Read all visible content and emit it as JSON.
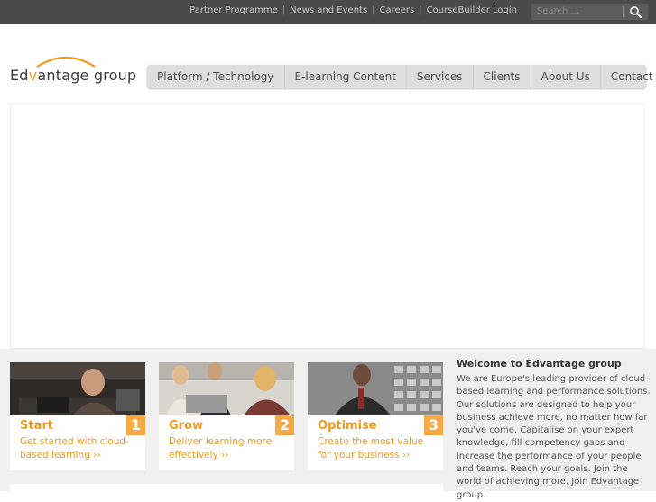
{
  "topbar": {
    "links": [
      "Partner Programme",
      "News and Events",
      "Careers",
      "CourseBuilder Login"
    ],
    "search_placeholder": "Search ..."
  },
  "logo": {
    "text_left": "Ed",
    "text_mid": "v",
    "text_right": "antage group"
  },
  "nav": {
    "items": [
      "Platform / Technology",
      "E-learning Content",
      "Services",
      "Clients",
      "About Us",
      "Contact Us"
    ]
  },
  "cards": [
    {
      "number": "1",
      "title": "Start",
      "desc": "Get started with cloud-based learning ››"
    },
    {
      "number": "2",
      "title": "Grow",
      "desc": "Deliver learning more effectively ››"
    },
    {
      "number": "3",
      "title": "Optimise",
      "desc": "Create the most value for your business ››"
    }
  ],
  "welcome": {
    "title": "Welcome to Edvantage group",
    "body": "We are Europe's leading provider of cloud-based learning and performance solutions. Our solutions are designed to help your business achieve more, no matter how far you've come. Capitalise on your expert knowledge, fill competency gaps and increase the performance of your people and teams. Reach your goals. Join the world of achieving more. Join Edvantage group."
  },
  "colors": {
    "accent": "#f29a1e",
    "topbar": "#4a4a4a",
    "nav": "#dedede"
  }
}
